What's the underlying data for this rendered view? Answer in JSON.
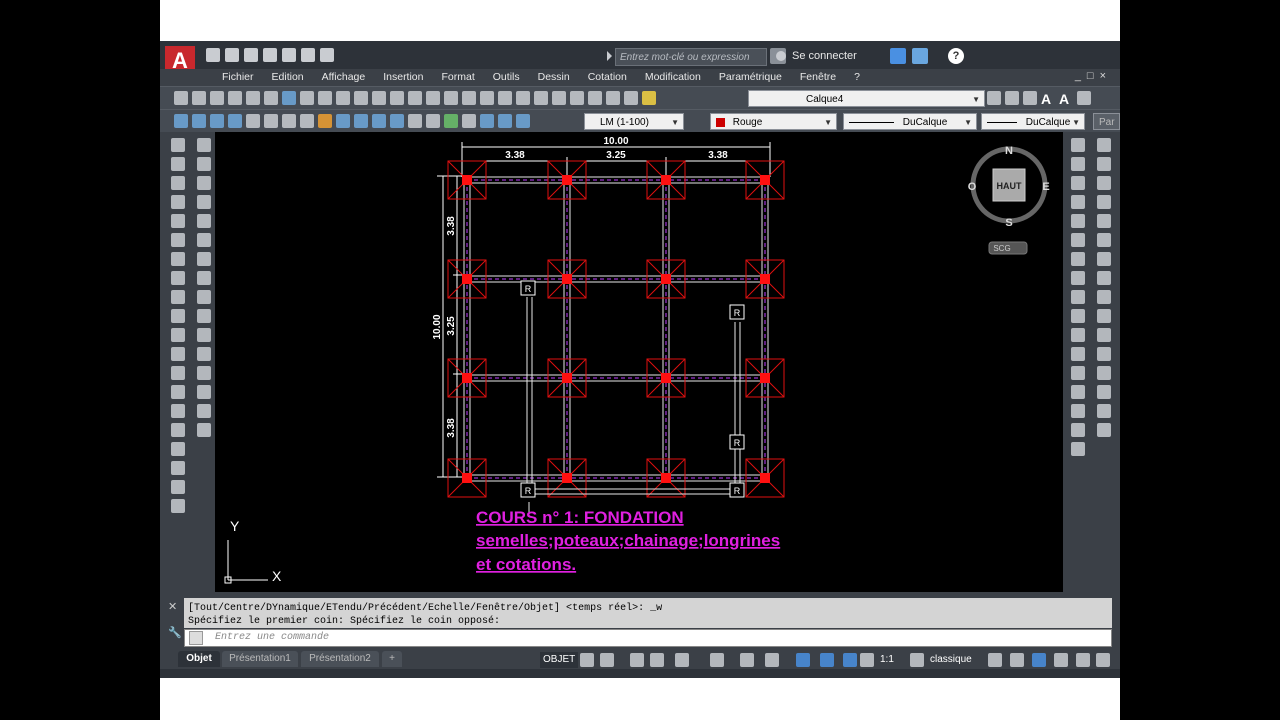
{
  "app": {
    "logo": "A",
    "search_placeholder": "Entrez mot-clé ou expression",
    "signin": "Se connecter",
    "help": "?"
  },
  "menu": [
    "Fichier",
    "Edition",
    "Affichage",
    "Insertion",
    "Format",
    "Outils",
    "Dessin",
    "Cotation",
    "Modification",
    "Paramétrique",
    "Fenêtre",
    "?"
  ],
  "toolbar": {
    "layer": "Calque4",
    "scale": "LM  (1-100)",
    "color": "Rouge",
    "color_hex": "#cc0000",
    "linetype": "DuCalque",
    "lineweight": "DuCalque",
    "plot": "Par"
  },
  "viewcube": {
    "north": "N",
    "south": "S",
    "east": "E",
    "west": "O",
    "top": "HAUT",
    "wcs": "SCG"
  },
  "drawing": {
    "dim_total_h": "10.00",
    "dim_spans_h": [
      "3.38",
      "3.25",
      "3.38"
    ],
    "dim_total_v": "10.00",
    "dim_spans_v": [
      "3.38",
      "3.25",
      "3.38"
    ],
    "regard": "R",
    "title_lines": [
      "COURS n° 1: FONDATION",
      "semelles;poteaux;chainage;longrines",
      "et cotations."
    ],
    "title_color": "#e020e0",
    "ucs_x": "X",
    "ucs_y": "Y"
  },
  "command": {
    "line1": "[Tout/Centre/DYnamique/ETendu/Précédent/Echelle/Fenêtre/Objet] <temps réel>: _w",
    "line2": "Spécifiez le premier coin: Spécifiez le coin opposé:",
    "placeholder": "Entrez une commande"
  },
  "tabs": [
    "Objet",
    "Présentation1",
    "Présentation2",
    "+"
  ],
  "status": {
    "mode": "OBJET",
    "scale": "1:1",
    "workspace": "classique"
  }
}
